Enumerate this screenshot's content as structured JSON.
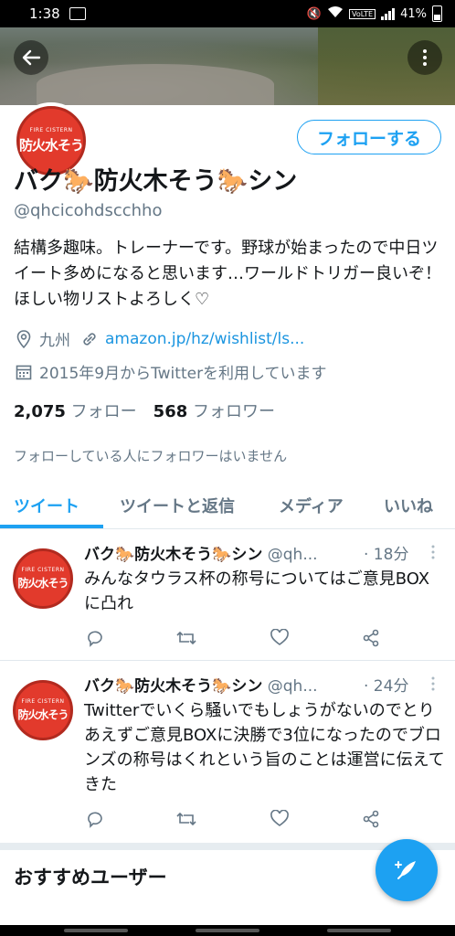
{
  "status_bar": {
    "time": "1:38",
    "battery": "41%",
    "volte": "VoLTE"
  },
  "profile": {
    "name": "バク🐎防火木そう🐎シン",
    "handle": "@qhcicohdscchho",
    "follow_label": "フォローする",
    "bio": "結構多趣味。トレーナーです。野球が始まったので中日ツイート多めになると思います…ワールドトリガー良いぞ！ほしい物リストよろしく♡",
    "location": "九州",
    "link": "amazon.jp/hz/wishlist/ls...",
    "joined": "2015年9月からTwitterを利用しています",
    "following_count": "2,075",
    "following_label": "フォロー",
    "followers_count": "568",
    "followers_label": "フォロワー",
    "no_mutual_followers": "フォローしている人にフォロワーはいません",
    "avatar_text_small": "FIRE CISTERN",
    "avatar_text_big": "防火水そう"
  },
  "tabs": [
    {
      "label": "ツイート",
      "active": true
    },
    {
      "label": "ツイートと返信",
      "active": false
    },
    {
      "label": "メディア",
      "active": false
    },
    {
      "label": "いいね",
      "active": false
    }
  ],
  "tweets": [
    {
      "name": "バク🐎防火木そう🐎シン",
      "handle": "@qh...",
      "time": "· 18分",
      "text": "みんなタウラス杯の称号についてはご意見BOXに凸れ"
    },
    {
      "name": "バク🐎防火木そう🐎シン",
      "handle": "@qh...",
      "time": "· 24分",
      "text": "Twitterでいくら騒いでもしょうがないのでとりあえずご意見BOXに決勝で3位になったのでブロンズの称号はくれという旨のことは運営に伝えてきた"
    }
  ],
  "recommend_title": "おすすめユーザー",
  "colors": {
    "accent": "#1da1f2",
    "secondary_text": "#657786",
    "avatar_red": "#e23a2c"
  },
  "icons": [
    "back-arrow-icon",
    "more-vert-icon",
    "location-icon",
    "link-icon",
    "calendar-icon",
    "reply-icon",
    "retweet-icon",
    "like-icon",
    "share-icon",
    "caret-down-icon",
    "compose-icon"
  ]
}
